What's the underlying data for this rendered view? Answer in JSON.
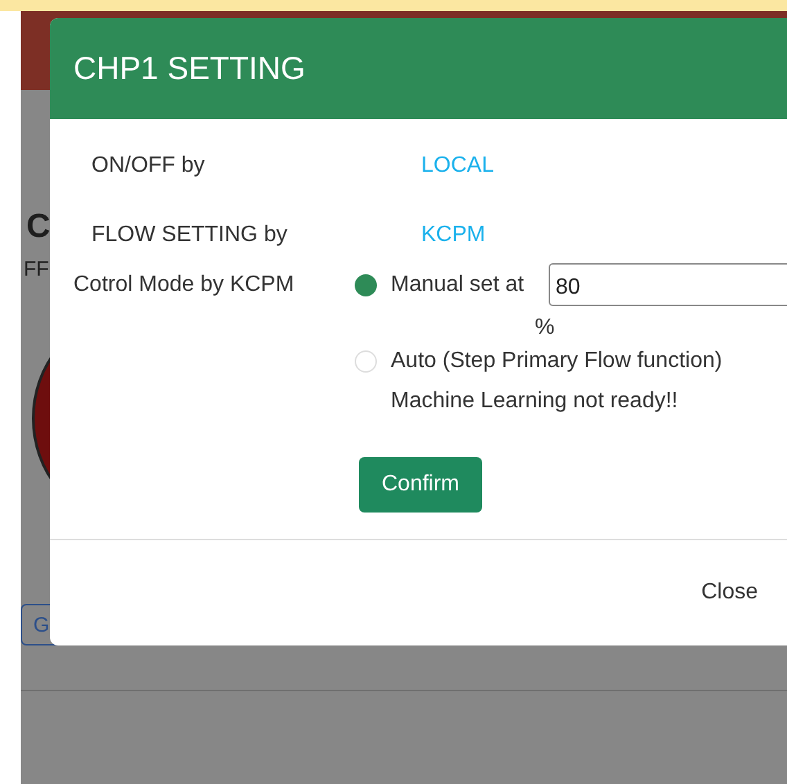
{
  "backdrop": {
    "heading": "C",
    "label": "FF",
    "button": "G"
  },
  "dialog": {
    "title": "CHP1 SETTING",
    "rows": [
      {
        "label": "ON/OFF by",
        "value": "LOCAL"
      },
      {
        "label": "FLOW SETTING by",
        "value": "KCPM"
      }
    ],
    "control_mode": {
      "label": "Cotrol Mode by KCPM",
      "options": [
        {
          "kind": "manual",
          "label": "Manual set at",
          "selected": true,
          "value": "80",
          "unit": "%"
        },
        {
          "kind": "auto",
          "label": "Auto (Step Primary Flow function)",
          "selected": false,
          "note": "Machine Learning not ready!!"
        }
      ]
    },
    "confirm": "Confirm",
    "close": "Close"
  }
}
